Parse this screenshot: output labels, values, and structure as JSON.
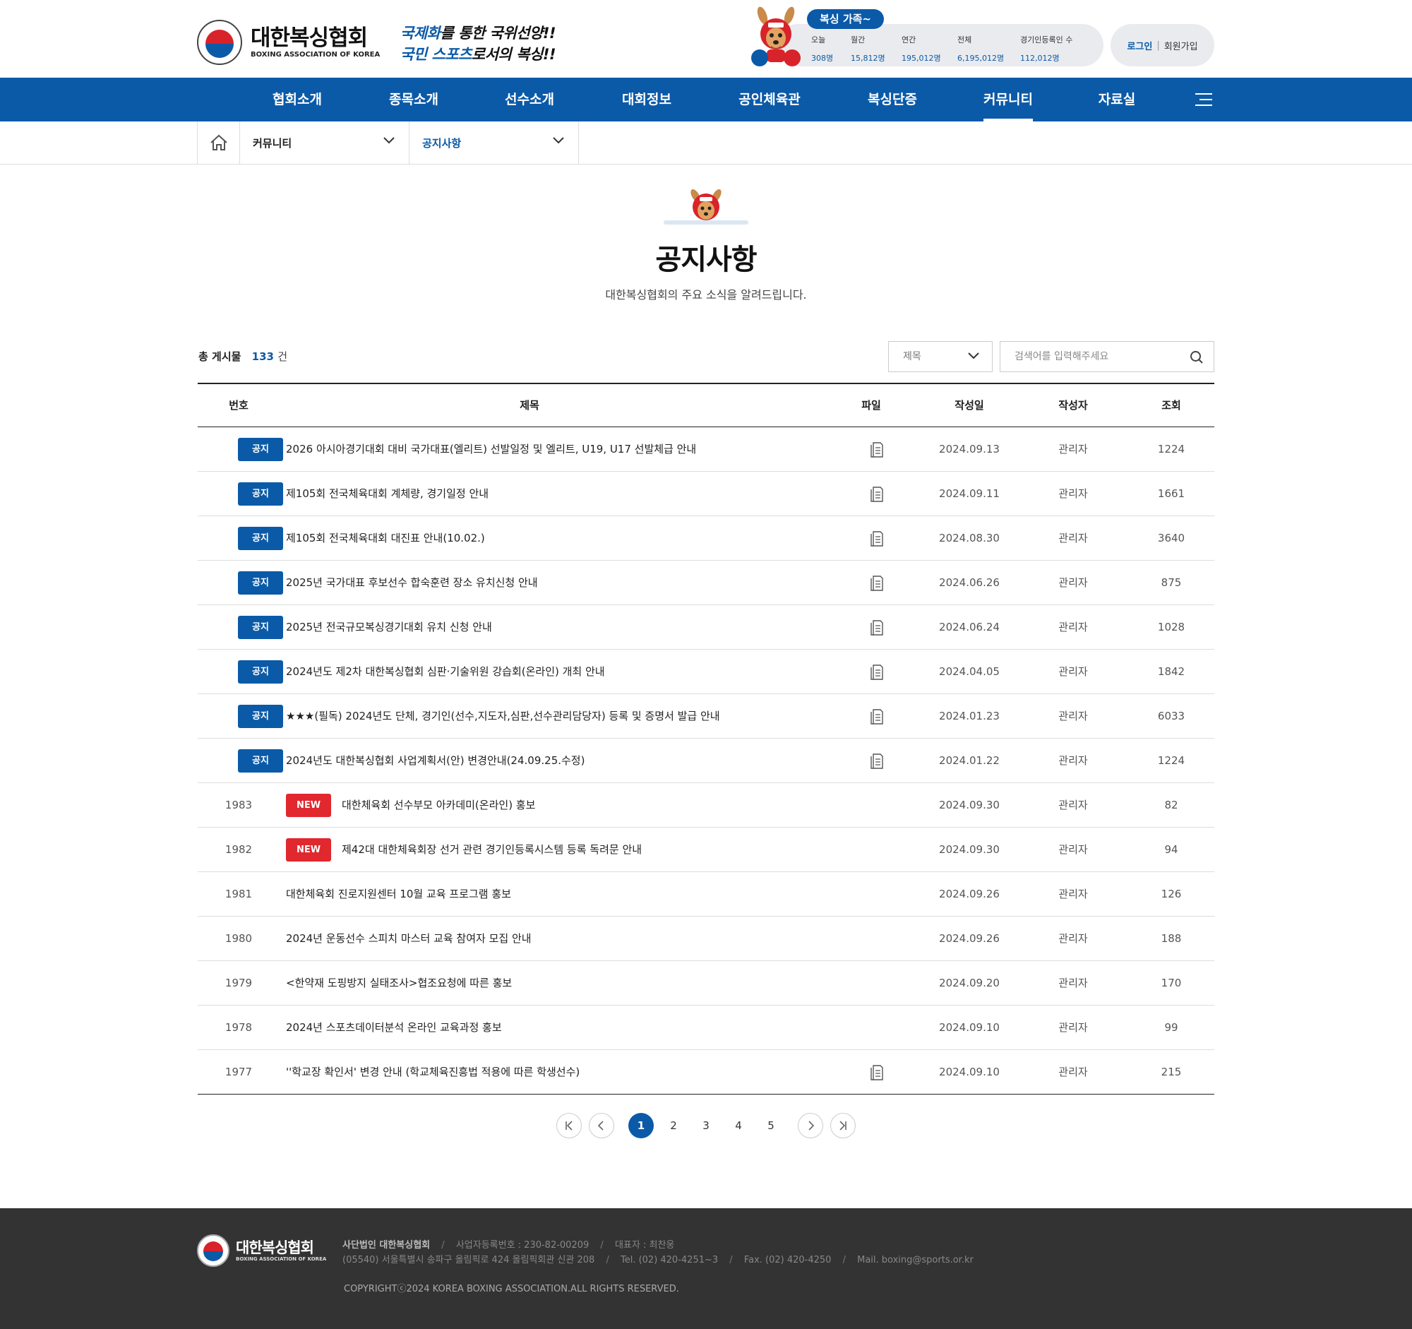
{
  "brand": {
    "name_ko": "대한복싱협회",
    "name_en": "BOXING ASSOCIATION OF KOREA",
    "slogan_line1_hl": "국제화",
    "slogan_line1_rest": "를 통한 국위선양!!",
    "slogan_line2_hl": "국민 스포츠",
    "slogan_line2_rest": "로서의 복싱!!"
  },
  "stats": {
    "tag": "복싱 가족~",
    "items": [
      {
        "label": "오늘",
        "value": "308명"
      },
      {
        "label": "월간",
        "value": "15,812명"
      },
      {
        "label": "연간",
        "value": "195,012명"
      },
      {
        "label": "전체",
        "value": "6,195,012명"
      },
      {
        "label": "경기인등록인 수",
        "value": "112,012명"
      }
    ]
  },
  "auth": {
    "login": "로그인",
    "separator": "|",
    "join": "회원가입"
  },
  "nav": {
    "items": [
      "협회소개",
      "종목소개",
      "선수소개",
      "대회정보",
      "공인체육관",
      "복싱단증",
      "커뮤니티",
      "자료실"
    ],
    "active": "커뮤니티"
  },
  "breadcrumb": {
    "level1": "커뮤니티",
    "level2": "공지사항"
  },
  "page": {
    "title": "공지사항",
    "subtitle": "대한복싱협회의 주요 소식을 알려드립니다."
  },
  "toolbar": {
    "total_label": "총 게시물",
    "total_count": "133",
    "total_unit": "건",
    "search_field": "제목",
    "search_placeholder": "검색어를 입력해주세요"
  },
  "table": {
    "columns": [
      "번호",
      "제목",
      "파일",
      "작성일",
      "작성자",
      "조회"
    ],
    "rows": [
      {
        "num": "",
        "badge": "공지",
        "badge_type": "notice",
        "title": "2026 아시아경기대회 대비 국가대표(엘리트) 선발일정 및 엘리트, U19, U17 선발체급 안내",
        "file": true,
        "date": "2024.09.13",
        "author": "관리자",
        "views": "1224"
      },
      {
        "num": "",
        "badge": "공지",
        "badge_type": "notice",
        "title": "제105회 전국체육대회 계체량, 경기일정 안내",
        "file": true,
        "date": "2024.09.11",
        "author": "관리자",
        "views": "1661"
      },
      {
        "num": "",
        "badge": "공지",
        "badge_type": "notice",
        "title": "제105회 전국체육대회 대진표 안내(10.02.)",
        "file": true,
        "date": "2024.08.30",
        "author": "관리자",
        "views": "3640"
      },
      {
        "num": "",
        "badge": "공지",
        "badge_type": "notice",
        "title": "2025년 국가대표 후보선수 합숙훈련 장소 유치신청 안내",
        "file": true,
        "date": "2024.06.26",
        "author": "관리자",
        "views": "875"
      },
      {
        "num": "",
        "badge": "공지",
        "badge_type": "notice",
        "title": "2025년 전국규모복싱경기대회 유치 신청 안내",
        "file": true,
        "date": "2024.06.24",
        "author": "관리자",
        "views": "1028"
      },
      {
        "num": "",
        "badge": "공지",
        "badge_type": "notice",
        "title": "2024년도 제2차 대한복싱협회 심판·기술위원 강습회(온라인) 개최 안내",
        "file": true,
        "date": "2024.04.05",
        "author": "관리자",
        "views": "1842"
      },
      {
        "num": "",
        "badge": "공지",
        "badge_type": "notice",
        "title": "★★★(필독) 2024년도 단체, 경기인(선수,지도자,심판,선수관리담당자) 등록 및 증명서 발급 안내",
        "file": true,
        "date": "2024.01.23",
        "author": "관리자",
        "views": "6033"
      },
      {
        "num": "",
        "badge": "공지",
        "badge_type": "notice",
        "title": "2024년도 대한복싱협회 사업계획서(안) 변경안내(24.09.25.수정)",
        "file": true,
        "date": "2024.01.22",
        "author": "관리자",
        "views": "1224"
      },
      {
        "num": "1983",
        "badge": "NEW",
        "badge_type": "new",
        "title": "대한체육회 선수부모 아카데미(온라인) 홍보",
        "file": false,
        "date": "2024.09.30",
        "author": "관리자",
        "views": "82"
      },
      {
        "num": "1982",
        "badge": "NEW",
        "badge_type": "new",
        "title": "제42대 대한체육회장 선거 관련 경기인등록시스템 등록 독려문 안내",
        "file": false,
        "date": "2024.09.30",
        "author": "관리자",
        "views": "94"
      },
      {
        "num": "1981",
        "badge": "",
        "badge_type": "",
        "title": "대한체육회 진로지원센터 10월 교육 프로그램 홍보",
        "file": false,
        "date": "2024.09.26",
        "author": "관리자",
        "views": "126"
      },
      {
        "num": "1980",
        "badge": "",
        "badge_type": "",
        "title": "2024년 운동선수 스피치 마스터 교육 참여자 모집 안내",
        "file": false,
        "date": "2024.09.26",
        "author": "관리자",
        "views": "188"
      },
      {
        "num": "1979",
        "badge": "",
        "badge_type": "",
        "title": "<한약재 도핑방지 실태조사>협조요청에 따른 홍보",
        "file": false,
        "date": "2024.09.20",
        "author": "관리자",
        "views": "170"
      },
      {
        "num": "1978",
        "badge": "",
        "badge_type": "",
        "title": "2024년 스포츠데이터분석 온라인 교육과정 홍보",
        "file": false,
        "date": "2024.09.10",
        "author": "관리자",
        "views": "99"
      },
      {
        "num": "1977",
        "badge": "",
        "badge_type": "",
        "title": "''학교장 확인서' 변경 안내 (학교체육진흥법 적용에 따른 학생선수)",
        "file": true,
        "date": "2024.09.10",
        "author": "관리자",
        "views": "215"
      }
    ]
  },
  "pagination": {
    "pages": [
      "1",
      "2",
      "3",
      "4",
      "5"
    ],
    "current": "1"
  },
  "footer": {
    "org": "사단법인 대한복싱협회",
    "biz_no": "사업자등록번호 : 230-82-00209",
    "ceo": "대표자 : 최찬웅",
    "address": "(05540) 서울특별시 송파구 올림픽로 424 올림픽회관 신관 208",
    "tel": "Tel. (02) 420-4251~3",
    "fax": "Fax. (02) 420-4250",
    "mail": "Mail. boxing@sports.or.kr",
    "separator": "/",
    "copyright": "COPYRIGHTⓒ2024 KOREA BOXING ASSOCIATION.ALL RIGHTS RESERVED."
  },
  "colors": {
    "primary": "#0b5aa8",
    "new_badge": "#e0282e",
    "footer_bg": "#333333"
  }
}
